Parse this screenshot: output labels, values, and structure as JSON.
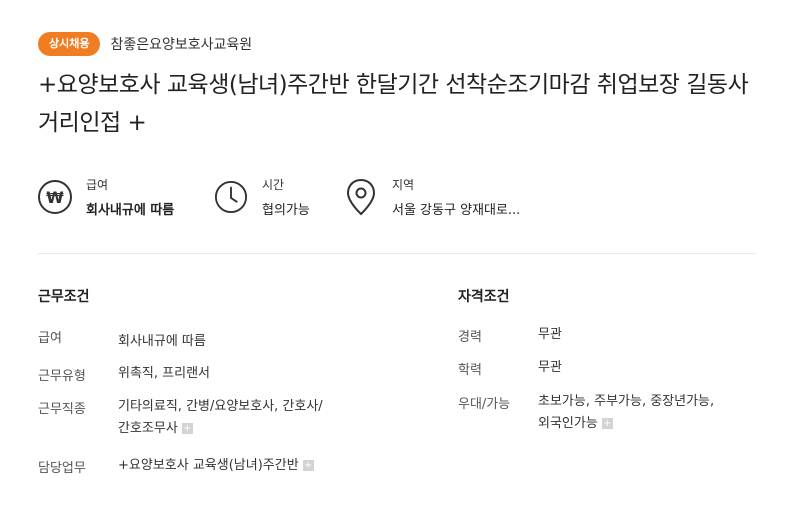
{
  "header": {
    "badge": "상시채용",
    "company": "참좋은요양보호사교육원"
  },
  "title": "+요양보호사 교육생(남녀)주간반 한달기간 선착순조기마감 취업보장 길동사거리인접 +",
  "summary": [
    {
      "icon": "won-icon",
      "label": "급여",
      "value": "회사내규에 따름"
    },
    {
      "icon": "clock-icon",
      "label": "시간",
      "value": "협의가능"
    },
    {
      "icon": "map-pin-icon",
      "label": "지역",
      "value": "서울 강동구 양재대로..."
    }
  ],
  "work_conditions": {
    "heading": "근무조건",
    "rows": [
      {
        "key": "급여",
        "value": "회사내규에 따름"
      },
      {
        "key": "근무유형",
        "value": "위촉직, 프리랜서"
      },
      {
        "key": "근무직종",
        "value_line1": "기타의료직, 간병/요양보호사, 간호사/",
        "value_line2": "간호조무사"
      },
      {
        "key": "담당업무",
        "value": "+요양보호사 교육생(남녀)주간반"
      }
    ]
  },
  "qualifications": {
    "heading": "자격조건",
    "rows": [
      {
        "key": "경력",
        "value": "무관"
      },
      {
        "key": "학력",
        "value": "무관"
      },
      {
        "key": "우대/가능",
        "value_line1": "초보가능, 주부가능, 중장년가능,",
        "value_line2": "외국인가능"
      }
    ]
  },
  "colors": {
    "badge": "#f07d22"
  }
}
